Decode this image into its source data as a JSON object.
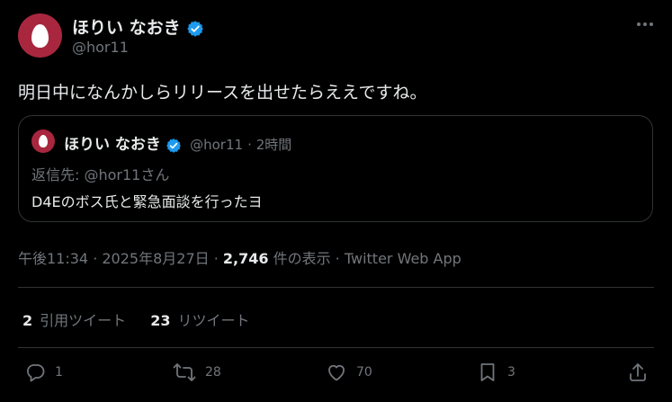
{
  "author": {
    "name": "ほりい なおき",
    "handle": "@hor11"
  },
  "tweet": {
    "text": "明日中になんかしらリリースを出せたらええですね。"
  },
  "quote": {
    "name": "ほりい なおき",
    "handle": "@hor11",
    "time": "· 2時間",
    "reply_to": "返信先: @hor11さん",
    "text": "D4Eのボス氏と緊急面談を行ったヨ"
  },
  "meta": {
    "timestamp": "午後11:34 · 2025年8月27日 · ",
    "views_count": "2,746",
    "views_label": " 件の表示 · ",
    "source": "Twitter Web App"
  },
  "stats": {
    "quote_count": "2",
    "quote_label": "引用ツイート",
    "retweet_count": "23",
    "retweet_label": "リツイート"
  },
  "actions": {
    "reply": "1",
    "retweet": "28",
    "like": "70",
    "bookmark": "3"
  },
  "colors": {
    "verified": "#1d9bf0",
    "avatar": "#a8273f",
    "muted": "#71767b"
  },
  "icons": [
    "verified-badge-icon",
    "more-icon",
    "reply-icon",
    "retweet-icon",
    "like-icon",
    "bookmark-icon",
    "share-icon"
  ]
}
